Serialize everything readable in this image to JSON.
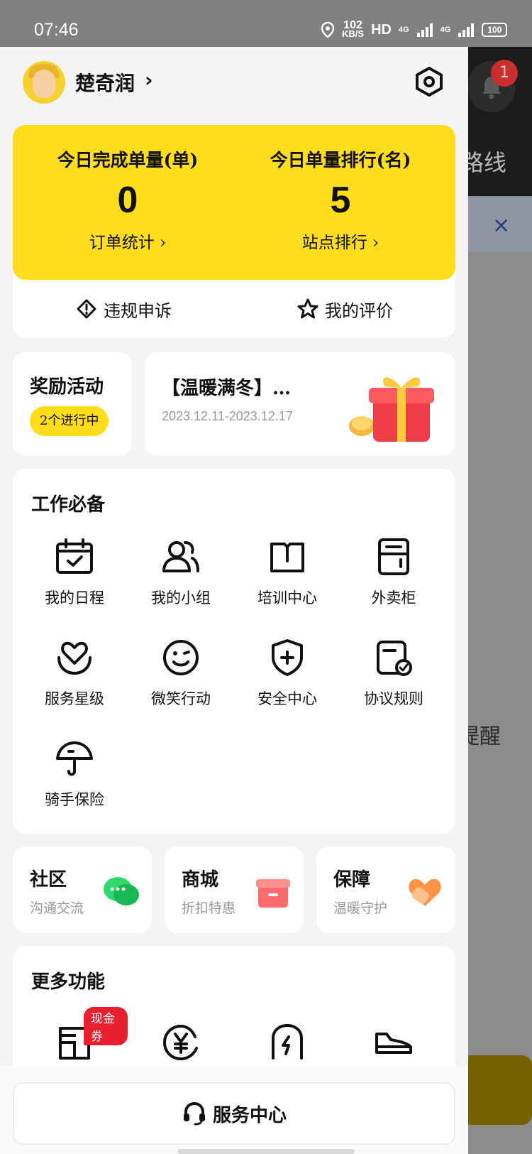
{
  "status_bar": {
    "time": "07:46",
    "speed_value": "102",
    "speed_unit": "KB/S",
    "hd": "HD",
    "net1": "4G",
    "net2": "4G",
    "battery": "100"
  },
  "background": {
    "route_text": "路线",
    "badge_count": "1",
    "remind_text": "提醒",
    "close_symbol": "×"
  },
  "user": {
    "name": "楚奇润",
    "chevron": "›"
  },
  "stats": {
    "left": {
      "label": "今日完成单量(单)",
      "value": "0",
      "link": "订单统计 ›"
    },
    "right": {
      "label": "今日单量排行(名)",
      "value": "5",
      "link": "站点排行 ›"
    },
    "actions": [
      {
        "label": "违规申诉",
        "icon": "appeal-icon"
      },
      {
        "label": "我的评价",
        "icon": "star-icon"
      }
    ]
  },
  "reward": {
    "title": "奖励活动",
    "pill": "2个进行中"
  },
  "promo": {
    "title": "【温暖满冬】…",
    "date": "2023.12.11-2023.12.17"
  },
  "work": {
    "title": "工作必备",
    "items": [
      {
        "label": "我的日程",
        "icon": "calendar-icon"
      },
      {
        "label": "我的小组",
        "icon": "group-icon"
      },
      {
        "label": "培训中心",
        "icon": "book-icon"
      },
      {
        "label": "外卖柜",
        "icon": "cabinet-icon"
      },
      {
        "label": "服务星级",
        "icon": "heart-hands-icon"
      },
      {
        "label": "微笑行动",
        "icon": "smile-icon"
      },
      {
        "label": "安全中心",
        "icon": "shield-icon"
      },
      {
        "label": "协议规则",
        "icon": "agreement-icon"
      },
      {
        "label": "骑手保险",
        "icon": "umbrella-icon"
      }
    ]
  },
  "mini_cards": [
    {
      "title": "社区",
      "sub": "沟通交流",
      "icon": "chat-icon"
    },
    {
      "title": "商城",
      "sub": "折扣特惠",
      "icon": "shop-icon"
    },
    {
      "title": "保障",
      "sub": "温暖守护",
      "icon": "care-icon"
    }
  ],
  "more": {
    "title": "更多功能",
    "coupon": "现金券",
    "icons": [
      "store-icon",
      "yuan-icon",
      "charge-icon",
      "shoe-icon"
    ]
  },
  "footer": {
    "service_label": "服务中心"
  },
  "colors": {
    "accent": "#ffdd1a",
    "coupon": "#e8202e",
    "chat": "#1fc95b",
    "shop": "#f04a4a",
    "care": "#ff8a3d"
  }
}
